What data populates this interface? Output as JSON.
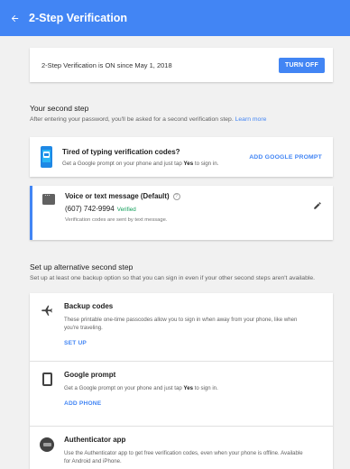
{
  "header": {
    "title": "2-Step Verification",
    "colors": {
      "appbar": "#4285f4"
    }
  },
  "status": {
    "text": "2-Step Verification is ON since May 1, 2018",
    "button": "TURN OFF"
  },
  "second_step": {
    "title": "Your second step",
    "desc": "After entering your password, you'll be asked for a second verification step.",
    "learn_more": "Learn more",
    "prompt_card": {
      "title": "Tired of typing verification codes?",
      "desc_pre": "Get a Google prompt on your phone and just tap ",
      "desc_bold": "Yes",
      "desc_post": " to sign in.",
      "action": "ADD GOOGLE PROMPT"
    },
    "voice_card": {
      "title": "Voice or text message (Default)",
      "number": "(607) 742-9994",
      "verified": "Verified",
      "desc": "Verification codes are sent by text message."
    }
  },
  "alt_step": {
    "title": "Set up alternative second step",
    "desc": "Set up at least one backup option so that you can sign in even if your other second steps aren't available.",
    "options": [
      {
        "icon": "airplane-icon",
        "title": "Backup codes",
        "desc": "These printable one-time passcodes allow you to sign in when away from your phone, like when you're traveling.",
        "action": "SET UP"
      },
      {
        "icon": "phone-outline-icon",
        "title": "Google prompt",
        "desc_pre": "Get a Google prompt on your phone and just tap ",
        "desc_bold": "Yes",
        "desc_post": " to sign in.",
        "action": "ADD PHONE"
      },
      {
        "icon": "authenticator-icon",
        "title": "Authenticator app",
        "desc": "Use the Authenticator app to get free verification codes, even when your phone is offline. Available for Android and iPhone."
      }
    ]
  }
}
